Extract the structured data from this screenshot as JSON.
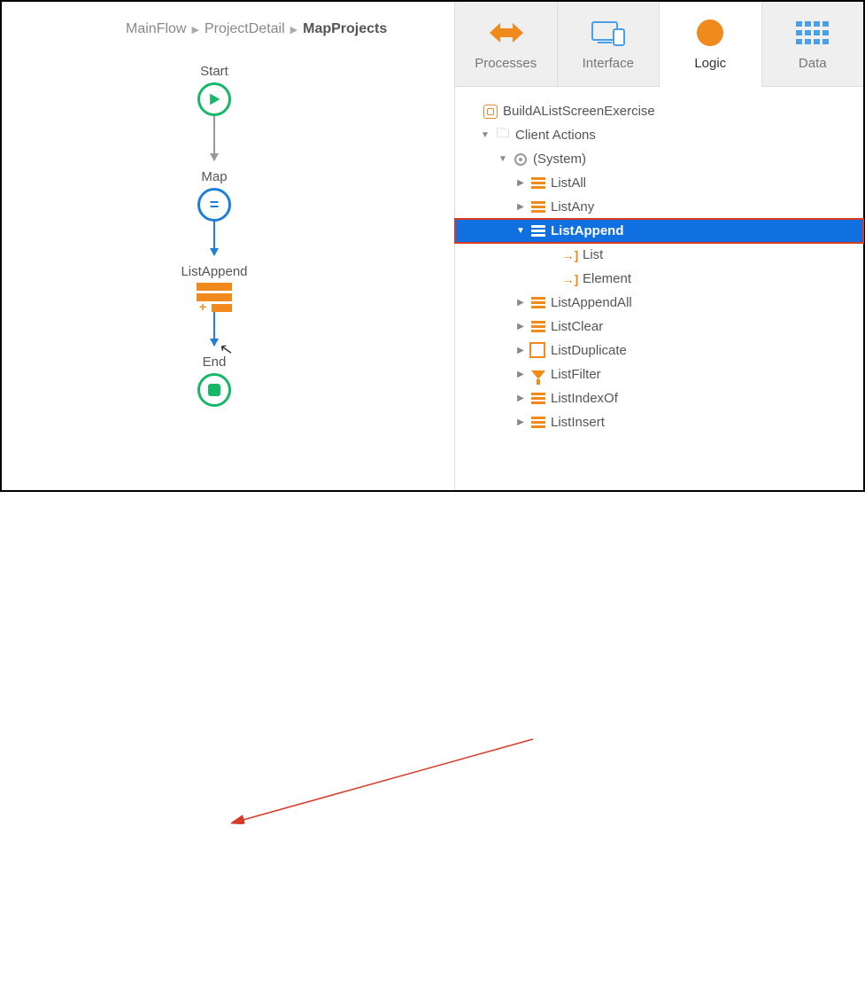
{
  "breadcrumb": {
    "a": "MainFlow",
    "b": "ProjectDetail",
    "c": "MapProjects"
  },
  "flow": {
    "start": "Start",
    "map": "Map",
    "listappend": "ListAppend",
    "end": "End"
  },
  "tabs": {
    "processes": "Processes",
    "interface": "Interface",
    "logic": "Logic",
    "data": "Data"
  },
  "tree": {
    "module": "BuildAListScreenExercise",
    "clientActions": "Client Actions",
    "system": "(System)",
    "items": {
      "listAll": "ListAll",
      "listAny": "ListAny",
      "listAppend": "ListAppend",
      "list": "List",
      "element": "Element",
      "listAppendAll": "ListAppendAll",
      "listClear": "ListClear",
      "listDuplicate": "ListDuplicate",
      "listFilter": "ListFilter",
      "listIndexOf": "ListIndexOf",
      "listInsert": "ListInsert"
    }
  }
}
